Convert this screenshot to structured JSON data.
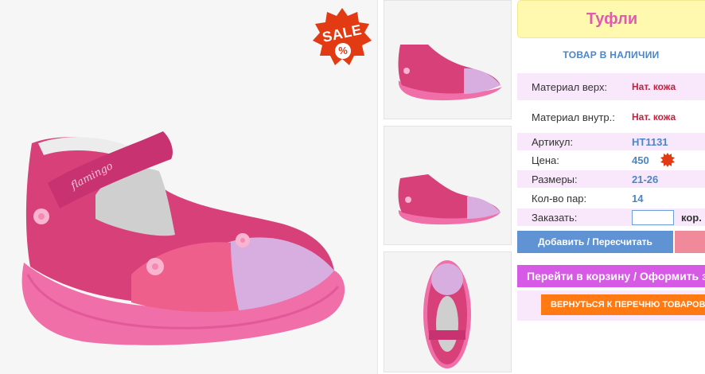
{
  "product": {
    "title": "Туфли",
    "stock_status": "ТОВАР В НАЛИЧИИ",
    "sale_badge": "SALE",
    "sale_badge_pct": "%",
    "brand_on_shoe": "flamingo"
  },
  "specs": [
    {
      "label": "Материал верх:",
      "value": "Нат. кожа"
    },
    {
      "label": "Материал внутр.:",
      "value": "Нат. кожа"
    },
    {
      "label": "Артикул:",
      "value": "HT1131"
    },
    {
      "label": "Цена:",
      "value": "450"
    },
    {
      "label": "Размеры:",
      "value": "21-26"
    },
    {
      "label": "Кол-во пар:",
      "value": "14"
    }
  ],
  "order": {
    "label": "Заказать:",
    "input_value": "",
    "unit": "кор."
  },
  "buttons": {
    "add": "Добавить / Пересчитать",
    "cart": "Перейти в корзину / Оформить заказ",
    "back": "ВЕРНУТЬСЯ К ПЕРЕЧНЮ ТОВАРОВ"
  },
  "colors": {
    "title_bg": "#fff9b0",
    "title_text": "#e05ab0",
    "accent_blue": "#5f93d4",
    "cart_purple": "#d65ae6",
    "back_orange": "#ff7a12",
    "row_pink": "#f9e8fb",
    "value_red": "#c5203b"
  },
  "icons": [
    "sale-badge-icon",
    "shoe-photo",
    "mini-sale-icon"
  ]
}
